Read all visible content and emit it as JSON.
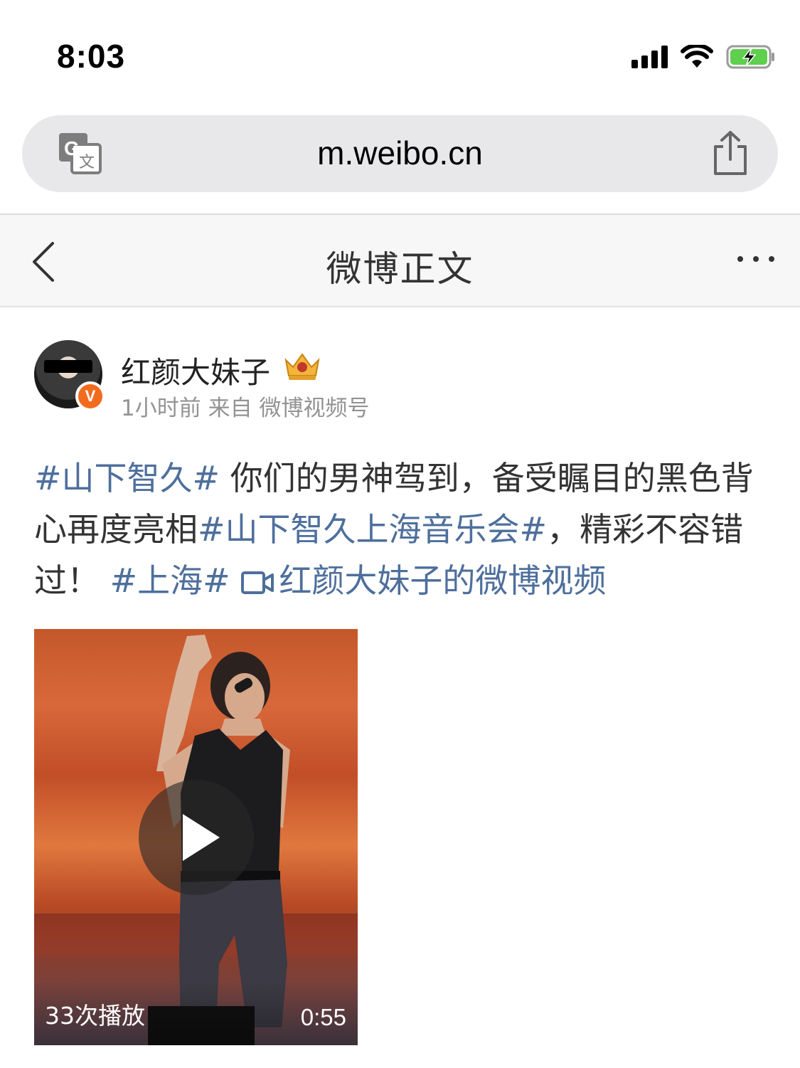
{
  "status_bar": {
    "time": "8:03",
    "icons": [
      "cellular-signal-icon",
      "wifi-icon",
      "battery-charging-icon"
    ]
  },
  "browser": {
    "url": "m.weibo.cn",
    "icons": [
      "translate-icon",
      "share-icon"
    ]
  },
  "nav": {
    "title": "微博正文",
    "icons": [
      "back-chevron-icon",
      "more-icon"
    ]
  },
  "post": {
    "author": {
      "name": "红颜大妹子",
      "verified_badge": "V",
      "badge_color": "#f26c1e",
      "crown_icon": "crown-icon",
      "time": "1小时前",
      "source_prefix": "来自",
      "source": "微博视频号"
    },
    "content": {
      "tag1": "#山下智久#",
      "text1": " 你们的男神驾到，备受瞩目的黑色背心再度亮相",
      "tag2": "#山下智久上海音乐会#",
      "text2": "，精彩不容错过！ ",
      "tag3": "#上海#",
      "video_link": "红颜大妹子的微博视频",
      "link_color": "#4e6f9c"
    },
    "video": {
      "play_count": "33次播放",
      "duration": "0:55"
    }
  }
}
